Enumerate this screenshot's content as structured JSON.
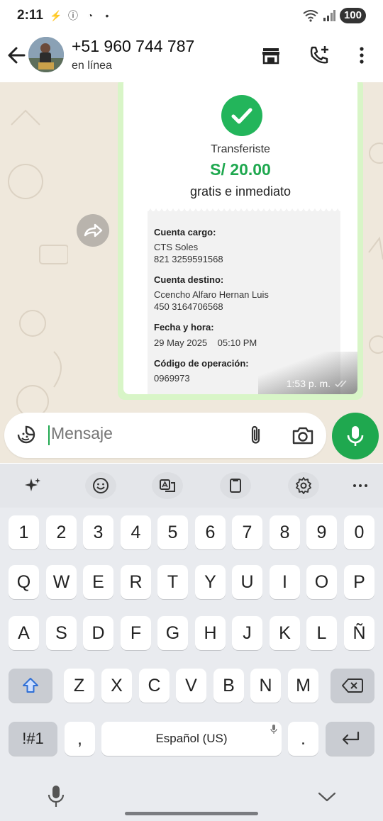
{
  "status_bar": {
    "time": "2:11",
    "battery": "100"
  },
  "header": {
    "contact_name": "+51 960 744 787",
    "contact_status": "en línea"
  },
  "message": {
    "receipt": {
      "title": "Transferiste",
      "amount": "S/ 20.00",
      "subtitle": "gratis e inmediato",
      "fields": [
        {
          "label": "Cuenta cargo:",
          "lines": [
            "CTS Soles",
            "821 3259591568"
          ]
        },
        {
          "label": "Cuenta destino:",
          "lines": [
            "Ccencho Alfaro Hernan Luis",
            "450 3164706568"
          ]
        },
        {
          "label": "Fecha y hora:",
          "lines": [
            "29 May 2025    05:10 PM"
          ]
        },
        {
          "label": "Código de operación:",
          "lines": [
            "0969973"
          ]
        }
      ]
    },
    "time": "1:53 p. m."
  },
  "input": {
    "placeholder": "Mensaje"
  },
  "keyboard": {
    "row_numbers": [
      "1",
      "2",
      "3",
      "4",
      "5",
      "6",
      "7",
      "8",
      "9",
      "0"
    ],
    "row_1": [
      "Q",
      "W",
      "E",
      "R",
      "T",
      "Y",
      "U",
      "I",
      "O",
      "P"
    ],
    "row_2": [
      "A",
      "S",
      "D",
      "F",
      "G",
      "H",
      "J",
      "K",
      "L",
      "Ñ"
    ],
    "row_3": [
      "Z",
      "X",
      "C",
      "V",
      "B",
      "N",
      "M"
    ],
    "symbols_key": "!#1",
    "comma_key": ",",
    "space_label": "Español (US)",
    "period_key": "."
  },
  "colors": {
    "accent_green": "#1fa84f",
    "bubble_green": "#d8f5c7",
    "chat_background": "#efe8dc"
  }
}
